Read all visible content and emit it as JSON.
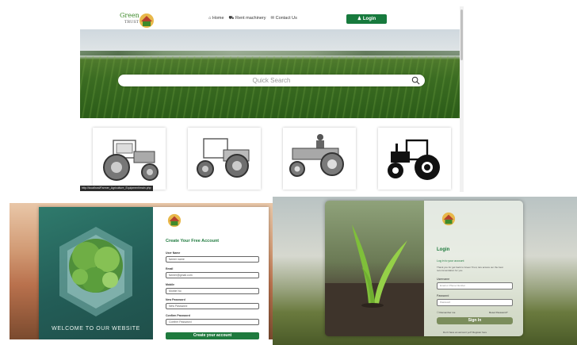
{
  "home": {
    "logo": {
      "name": "Green",
      "sub": "TRUST"
    },
    "nav": {
      "home": "⌂ Home",
      "rent": "⛟ Rent machinery",
      "contact": "✉ Contact Us"
    },
    "login_label": "Login",
    "search_placeholder": "Quick Search",
    "tractors": [
      {
        "name": "tractor-sketch-1"
      },
      {
        "name": "tractor-sketch-2"
      },
      {
        "name": "tractor-sketch-3"
      },
      {
        "name": "tractor-sketch-4"
      }
    ],
    "status_url": "http://localhost/Farmer_Agriculture_Equipment/main.php"
  },
  "signup": {
    "title": "Create Your Free Account",
    "welcome": "WELCOME TO OUR WEBSITE",
    "fields": [
      {
        "label": "User Name",
        "value": "farmer name"
      },
      {
        "label": "Email",
        "value": "farmer@gmail.com"
      },
      {
        "label": "Mobile",
        "value": "Mobile No"
      },
      {
        "label": "New Password",
        "value": "New Password"
      },
      {
        "label": "Confirm Password",
        "value": "Confirm Password"
      }
    ],
    "create_button": "Create your account"
  },
  "login": {
    "title": "Login",
    "subtitle": "Log in to your account",
    "description": "Thank you for get back to Green Trust, lets access our the best recommendation for you.",
    "username_label": "Username",
    "username_placeholder": "Email or Phone Number",
    "password_label": "Password",
    "password_placeholder": "Password",
    "remember": "Remember me",
    "forgot": "Reset Password?",
    "signin_button": "Sign In",
    "footer": "Don't have an account yet? Register here"
  },
  "colors": {
    "brand_green": "#177a3d",
    "signin_green": "#7b8d5c"
  }
}
